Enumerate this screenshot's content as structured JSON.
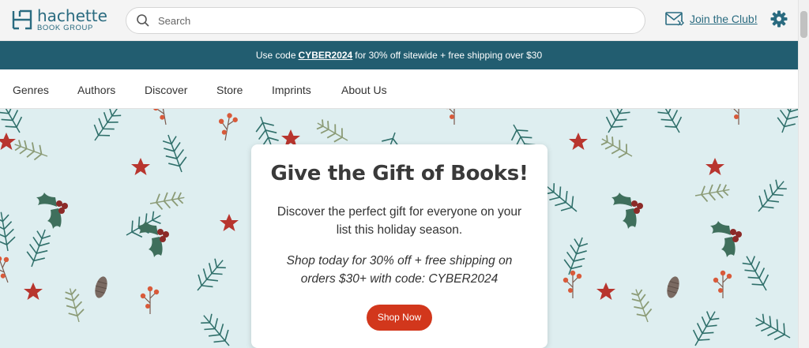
{
  "header": {
    "logo": {
      "name": "hachette",
      "sub": "BOOK GROUP",
      "icon": "hachette-logo-icon"
    },
    "search": {
      "placeholder": "Search",
      "icon": "search-icon"
    },
    "club": {
      "label": "Join the Club!",
      "icon": "mail-icon"
    },
    "settings_icon": "gear-icon"
  },
  "promo": {
    "prefix": "Use code",
    "code": "CYBER2024",
    "suffix": "for 30% off sitewide + free shipping over $30"
  },
  "nav": {
    "items": [
      {
        "label": "Genres"
      },
      {
        "label": "Authors"
      },
      {
        "label": "Discover"
      },
      {
        "label": "Store"
      },
      {
        "label": "Imprints"
      },
      {
        "label": "About Us"
      }
    ]
  },
  "hero": {
    "title": "Give the Gift of Books!",
    "body": "Discover the perfect gift for everyone on your list this holiday season.",
    "offer": "Shop today for 30% off + free shipping on orders $30+ with code: CYBER2024",
    "button": "Shop Now"
  },
  "colors": {
    "brand": "#2a6b80",
    "banner": "#225d70",
    "button": "#d2371c",
    "hero_bg": "#deeef0",
    "leaf": "#2f6f6a",
    "berry": "#b0302a"
  }
}
